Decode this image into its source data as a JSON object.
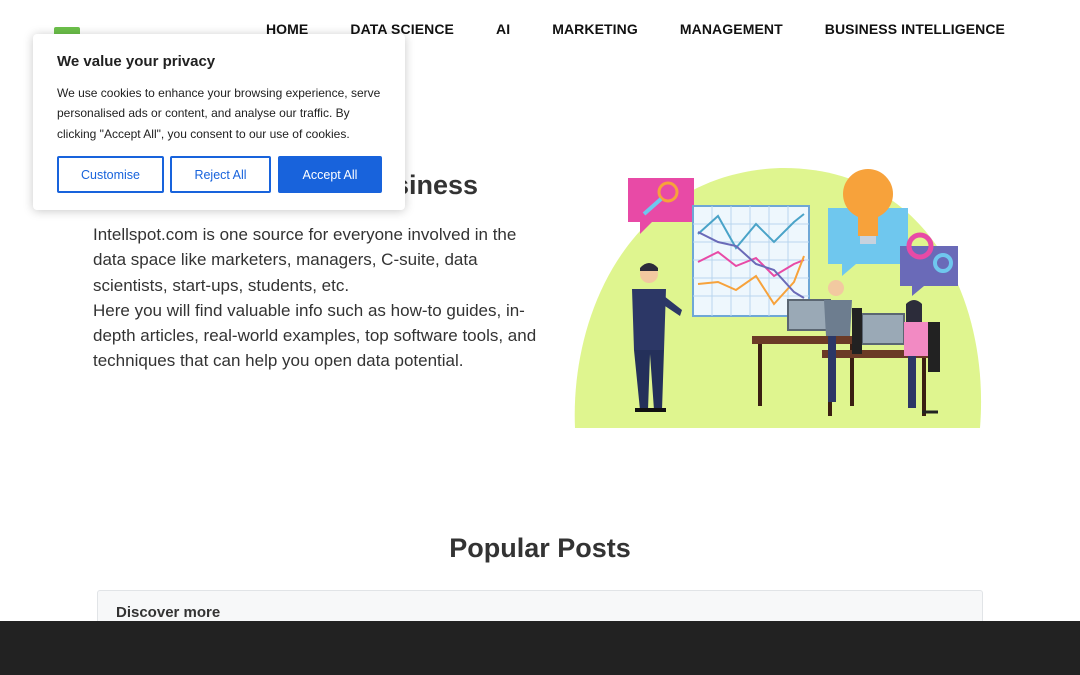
{
  "nav": {
    "items": [
      "HOME",
      "DATA SCIENCE",
      "AI",
      "MARKETING",
      "MANAGEMENT",
      "BUSINESS INTELLIGENCE"
    ]
  },
  "hero": {
    "title_visible": "siness",
    "paragraph1": "Intellspot.com is one source for everyone involved in the data space like marketers, managers, C-suite, data scientists, start-ups, students, etc.",
    "paragraph2": "Here you will find valuable info such as how-to guides, in-depth articles, real-world examples, top software tools, and techniques that can help you open data potential."
  },
  "popular": {
    "title": "Popular Posts",
    "discover_label": "Discover more"
  },
  "cookie": {
    "title": "We value your privacy",
    "text": "We use cookies to enhance your browsing experience, serve personalised ads or content, and analyse our traffic. By clicking \"Accept All\", you consent to our use of cookies.",
    "customise_label": "Customise",
    "reject_label": "Reject All",
    "accept_label": "Accept All"
  },
  "colors": {
    "brand_green": "#6cc04a",
    "cookie_accent": "#1863dc",
    "footer_bg": "#222222",
    "illustration_blob": "#dff58f"
  },
  "icons": [
    "site-logo",
    "hero-illustration"
  ]
}
